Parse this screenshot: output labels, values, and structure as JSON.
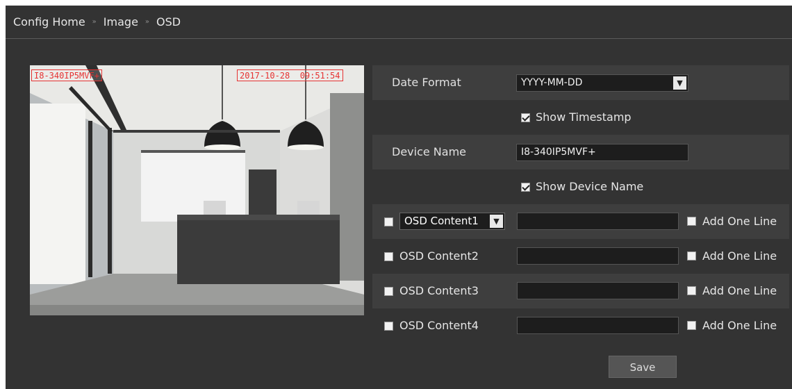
{
  "breadcrumb": {
    "items": [
      "Config Home",
      "Image",
      "OSD"
    ],
    "separator": "»"
  },
  "preview": {
    "osd_device_name": "I8-340IP5MVF+",
    "osd_timestamp": "2017-10-28  09:51:54",
    "scene": "office-lobby-camera-view"
  },
  "form": {
    "date_format": {
      "label": "Date Format",
      "value": "YYYY-MM-DD"
    },
    "show_timestamp": {
      "label": "Show Timestamp",
      "checked": true
    },
    "device_name": {
      "label": "Device Name",
      "value": "I8-340IP5MVF+"
    },
    "show_device_name": {
      "label": "Show Device Name",
      "checked": true
    },
    "osd_contents": [
      {
        "label": "OSD Content1",
        "checked": false,
        "value": "",
        "add_one_line": "Add One Line",
        "add_checked": false
      },
      {
        "label": "OSD Content2",
        "checked": false,
        "value": "",
        "add_one_line": "Add One Line",
        "add_checked": false
      },
      {
        "label": "OSD Content3",
        "checked": false,
        "value": "",
        "add_one_line": "Add One Line",
        "add_checked": false
      },
      {
        "label": "OSD Content4",
        "checked": false,
        "value": "",
        "add_one_line": "Add One Line",
        "add_checked": false
      }
    ],
    "save_label": "Save"
  },
  "icons": {
    "dropdown": "chevron-down-icon",
    "checkbox": "checkbox"
  },
  "colors": {
    "background": "#333333",
    "row_dark": "#3e3e3e",
    "osd_red": "#e63232"
  }
}
